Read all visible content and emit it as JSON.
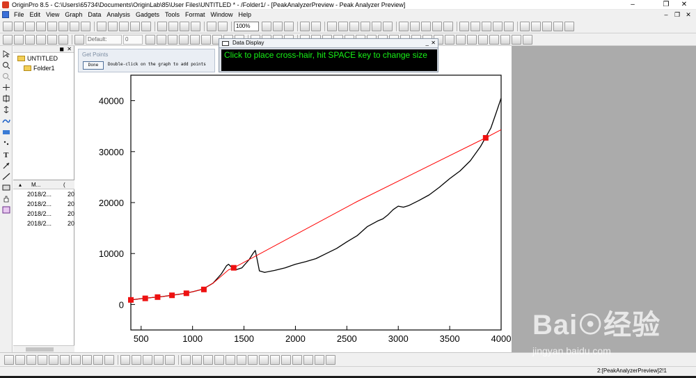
{
  "window": {
    "title": "OriginPro 8.5 - C:\\Users\\65734\\Documents\\OriginLab\\85\\User Files\\UNTITLED * - /Folder1/ - [PeakAnalyzerPreview - Peak Analyzer Preview]"
  },
  "menu": {
    "items": [
      "File",
      "Edit",
      "View",
      "Graph",
      "Data",
      "Analysis",
      "Gadgets",
      "Tools",
      "Format",
      "Window",
      "Help"
    ]
  },
  "toolbar": {
    "zoom": "100%",
    "font_name": "Default: ",
    "font_size": "0"
  },
  "explorer": {
    "root": "UNTITLED",
    "folder": "Folder1",
    "columns": [
      "▴",
      "M...",
      "("
    ],
    "rows": [
      {
        "name": "2018/2...",
        "extra": "20"
      },
      {
        "name": "2018/2...",
        "extra": "20"
      },
      {
        "name": "2018/2...",
        "extra": "20"
      },
      {
        "name": "2018/2...",
        "extra": "20"
      }
    ]
  },
  "get_points": {
    "title": "Get Points",
    "done_label": "Done",
    "message": "Double-click on the graph to add points"
  },
  "data_display": {
    "title": "Data Display",
    "message": "Click to place cross-hair, hit SPACE key to change size",
    "text_color": "#17f217"
  },
  "status": {
    "text": "2:[PeakAnalyzerPreview]2!1"
  },
  "watermark": {
    "logo": "Bai☉经验",
    "url": "jingyan.baidu.com"
  },
  "colors": {
    "baseline": "#ff0000",
    "anchor_points": "#ee1111",
    "data_line": "#000000",
    "workspace_gray": "#ababab"
  },
  "chart_data": {
    "type": "line",
    "title": "",
    "xlabel": "",
    "ylabel": "",
    "xlim": [
      400,
      4000
    ],
    "ylim": [
      -5000,
      45000
    ],
    "xticks": [
      500,
      1000,
      1500,
      2000,
      2500,
      3000,
      3500,
      4000
    ],
    "yticks": [
      0,
      10000,
      20000,
      30000,
      40000
    ],
    "series": [
      {
        "style": "line",
        "color": "#000000",
        "points": [
          [
            400,
            900
          ],
          [
            500,
            1150
          ],
          [
            600,
            1350
          ],
          [
            700,
            1550
          ],
          [
            800,
            1800
          ],
          [
            900,
            2100
          ],
          [
            1000,
            2500
          ],
          [
            1100,
            3000
          ],
          [
            1200,
            4200
          ],
          [
            1280,
            6000
          ],
          [
            1330,
            7600
          ],
          [
            1350,
            7900
          ],
          [
            1380,
            7300
          ],
          [
            1420,
            6800
          ],
          [
            1480,
            7200
          ],
          [
            1550,
            8800
          ],
          [
            1590,
            10100
          ],
          [
            1610,
            10600
          ],
          [
            1630,
            8600
          ],
          [
            1650,
            6600
          ],
          [
            1700,
            6300
          ],
          [
            1800,
            6700
          ],
          [
            1900,
            7200
          ],
          [
            2000,
            7900
          ],
          [
            2100,
            8400
          ],
          [
            2200,
            9000
          ],
          [
            2300,
            10000
          ],
          [
            2400,
            11000
          ],
          [
            2500,
            12300
          ],
          [
            2600,
            13500
          ],
          [
            2700,
            15300
          ],
          [
            2800,
            16400
          ],
          [
            2850,
            16800
          ],
          [
            2900,
            17600
          ],
          [
            2950,
            18600
          ],
          [
            3000,
            19300
          ],
          [
            3050,
            19100
          ],
          [
            3100,
            19400
          ],
          [
            3200,
            20400
          ],
          [
            3300,
            21500
          ],
          [
            3400,
            23000
          ],
          [
            3500,
            24700
          ],
          [
            3600,
            26200
          ],
          [
            3700,
            28200
          ],
          [
            3800,
            31000
          ],
          [
            3900,
            34600
          ],
          [
            3950,
            37500
          ],
          [
            4000,
            40500
          ]
        ]
      },
      {
        "style": "line",
        "color": "#ff0000",
        "points": [
          [
            400,
            900
          ],
          [
            500,
            1150
          ],
          [
            600,
            1350
          ],
          [
            700,
            1550
          ],
          [
            800,
            1800
          ],
          [
            900,
            2100
          ],
          [
            1000,
            2500
          ],
          [
            1100,
            3000
          ],
          [
            1200,
            4200
          ],
          [
            1350,
            6800
          ],
          [
            1400,
            7200
          ],
          [
            2600,
            20200
          ],
          [
            3850,
            32700
          ],
          [
            4000,
            34300
          ]
        ]
      },
      {
        "style": "markers",
        "color": "#ee1111",
        "points": [
          [
            400,
            900
          ],
          [
            540,
            1200
          ],
          [
            660,
            1450
          ],
          [
            800,
            1800
          ],
          [
            940,
            2200
          ],
          [
            1110,
            2950
          ],
          [
            1400,
            7200
          ],
          [
            3850,
            32700
          ]
        ]
      }
    ]
  }
}
